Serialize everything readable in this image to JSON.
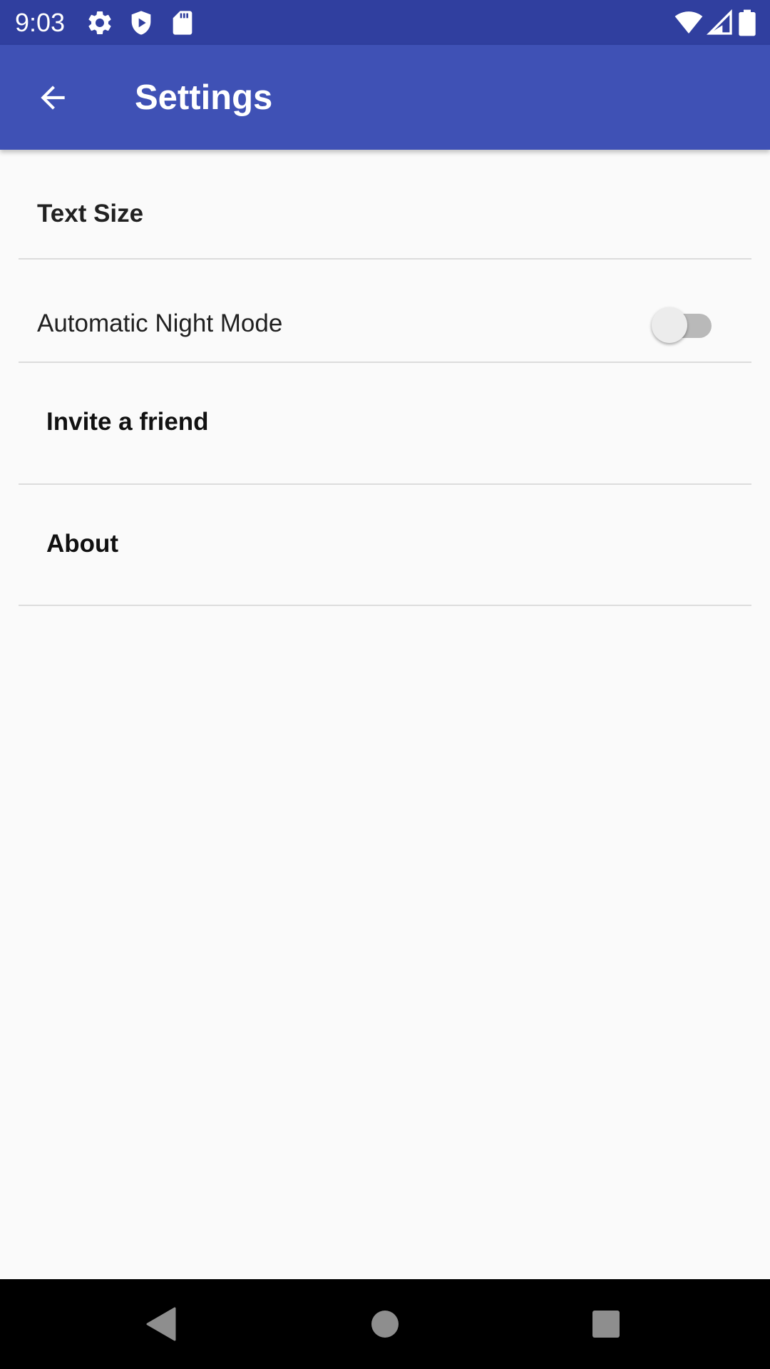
{
  "status_bar": {
    "time": "9:03",
    "left_icons": [
      "gear-icon",
      "shield-play-icon",
      "sd-card-icon"
    ],
    "right_icons": [
      "wifi-icon",
      "cellular-signal-icon",
      "battery-icon"
    ],
    "background_color": "#303f9f"
  },
  "app_bar": {
    "title": "Settings",
    "back_icon": "arrow-back-icon",
    "background_color": "#3f51b5"
  },
  "settings": {
    "items": [
      {
        "label": "Text Size"
      },
      {
        "label": "Automatic Night Mode",
        "toggle": {
          "enabled": false
        }
      },
      {
        "label": "Invite a friend"
      },
      {
        "label": "About"
      }
    ]
  },
  "nav_bar": {
    "buttons": [
      "back-triangle-icon",
      "home-circle-icon",
      "recents-square-icon"
    ]
  }
}
